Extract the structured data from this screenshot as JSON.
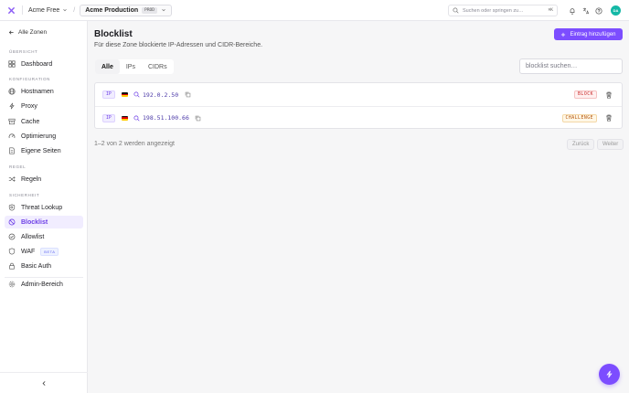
{
  "topbar": {
    "account": "Acme Free",
    "zone_name": "Acme Production",
    "zone_badge": "PROD",
    "search_placeholder": "Suchen oder springen zu…",
    "search_shortcut": "⌘K",
    "avatar_initials": "DA"
  },
  "sidebar": {
    "back_label": "Alle Zonen",
    "sections": {
      "overview": "ÜBERSICHT",
      "config": "KONFIGURATION",
      "rules": "REGEL",
      "security": "SICHERHEIT"
    },
    "items": {
      "dashboard": "Dashboard",
      "hostnames": "Hostnamen",
      "proxy": "Proxy",
      "cache": "Cache",
      "optimization": "Optimierung",
      "pages": "Eigene Seiten",
      "rules": "Regeln",
      "threat": "Threat Lookup",
      "blocklist": "Blocklist",
      "allowlist": "Allowlist",
      "waf": "WAF",
      "waf_badge": "BETA",
      "basic_auth": "Basic Auth",
      "admin": "Admin-Bereich"
    }
  },
  "main": {
    "title": "Blocklist",
    "subtitle": "Für diese Zone blockierte IP-Adressen und CIDR-Bereiche.",
    "add_button": "Eintrag hinzufügen",
    "tabs": [
      "Alle",
      "IPs",
      "CIDRs"
    ],
    "filter_placeholder": "blocklist suchen…",
    "entries": [
      {
        "type": "IP",
        "address": "192.0.2.50",
        "action": "BLOCK"
      },
      {
        "type": "IP",
        "address": "198.51.100.66",
        "action": "CHALLENGE"
      }
    ],
    "footer": "1–2 von 2 werden angezeigt",
    "prev_label": "Zurück",
    "next_label": "Weiter"
  },
  "colors": {
    "accent": "#7c4dff",
    "block": "#c92a2a",
    "challenge": "#b45309"
  }
}
